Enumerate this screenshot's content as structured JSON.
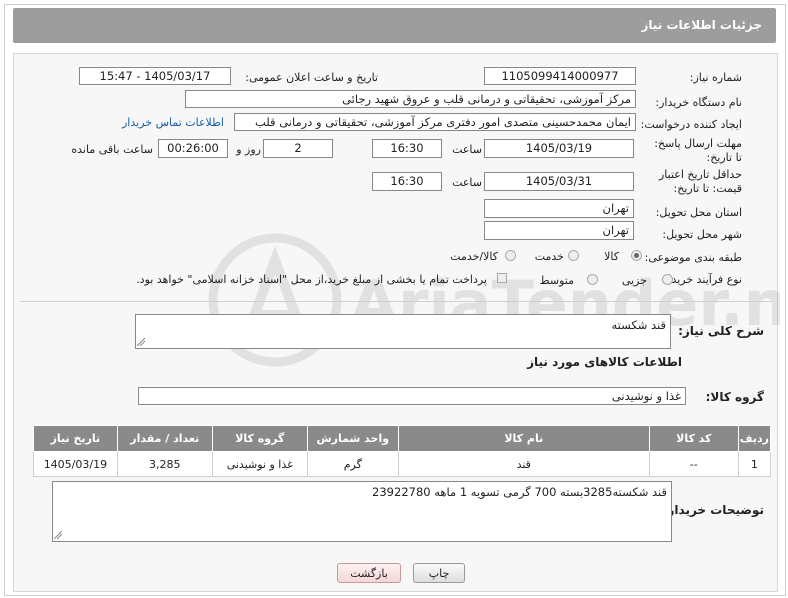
{
  "header": {
    "title": "جزئیات اطلاعات نیاز"
  },
  "fields": {
    "need_number_label": "شماره نیاز:",
    "need_number": "1105099414000977",
    "announce_label": "تاریخ و ساعت اعلان عمومی:",
    "announce_value": "1405/03/17 - 15:47",
    "buyer_label": "نام دستگاه خریدار:",
    "buyer_value": "مرکز آموزشی، تحقیقاتی و درمانی قلب و عروق شهید رجائی",
    "creator_label": "ایجاد کننده درخواست:",
    "creator_value": "ایمان محمدحسینی متصدی امور دفتری مرکز آموزشی، تحقیقاتی و درمانی قلب",
    "contact_link": "اطلاعات تماس خریدار",
    "deadline_label": "مهلت ارسال پاسخ: تا تاریخ:",
    "deadline_date": "1405/03/19",
    "time_label": "ساعت",
    "deadline_time": "16:30",
    "days_value": "2",
    "days_label": "روز و",
    "remaining_value": "00:26:00",
    "remaining_label": "ساعت باقی مانده",
    "validity_label": "حداقل تاریخ اعتبار قیمت: تا تاریخ:",
    "validity_date": "1405/03/31",
    "validity_time": "16:30",
    "province_label": "استان محل تحویل:",
    "province_value": "تهران",
    "city_label": "شهر محل تحویل:",
    "city_value": "تهران",
    "category_label": "طبقه بندی موضوعی:",
    "category_options": [
      "کالا",
      "خدمت",
      "کالا/خدمت"
    ],
    "process_label": "نوع فرآیند خرید :",
    "process_options": [
      "جزیی",
      "متوسط"
    ],
    "payment_text": "پرداخت تمام یا بخشی از مبلغ خرید،از محل \"اسناد خزانه اسلامی\" خواهد بود.",
    "description_label": "شرح کلی نیاز:",
    "description_value": "قند شکسته",
    "goods_info_title": "اطلاعات کالاهای مورد نیاز",
    "goods_group_label": "گروه کالا:",
    "goods_group_value": "غذا و نوشیدنی",
    "buyer_notes_label": "توضیحات خریدار:",
    "buyer_notes_value": "قند شکسته3285بسته 700 گرمی تسویه 1 ماهه 23922780"
  },
  "table": {
    "headers": [
      "ردیف",
      "کد کالا",
      "نام کالا",
      "واحد شمارش",
      "گروه کالا",
      "تعداد / مقدار",
      "تاریخ نیاز"
    ],
    "rows": [
      [
        "1",
        "--",
        "قند",
        "گرم",
        "غذا و نوشیدنی",
        "3,285",
        "1405/03/19"
      ]
    ]
  },
  "buttons": {
    "print": "چاپ",
    "back": "بازگشت"
  },
  "watermark": "AriaTender.net"
}
